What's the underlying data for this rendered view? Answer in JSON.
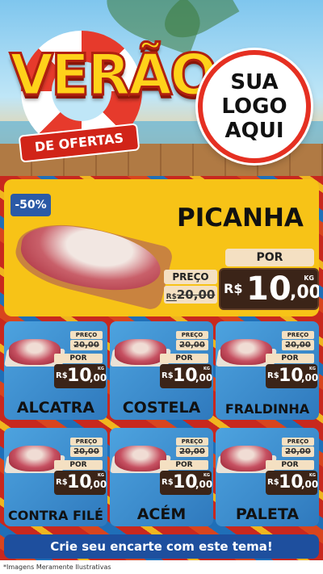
{
  "hero": {
    "title": "VERÃO",
    "subtitle": "DE OFERTAS",
    "logo_lines": [
      "SUA",
      "LOGO",
      "AQUI"
    ]
  },
  "featured": {
    "discount_badge": "-50%",
    "name": "PICANHA",
    "preco_label": "PREÇO",
    "old_price_currency": "R$",
    "old_price": "20,00",
    "por_label": "POR",
    "currency": "R$",
    "price_int": "10",
    "price_dec": ",00",
    "unit": "KG"
  },
  "products": [
    {
      "name": "ALCATRA",
      "preco_label": "PREÇO",
      "old_price": "20,00",
      "por_label": "POR",
      "currency": "R$",
      "price_int": "10",
      "price_dec": ",00",
      "unit": "KG"
    },
    {
      "name": "COSTELA",
      "preco_label": "PREÇO",
      "old_price": "20,00",
      "por_label": "POR",
      "currency": "R$",
      "price_int": "10",
      "price_dec": ",00",
      "unit": "KG"
    },
    {
      "name": "FRALDINHA",
      "preco_label": "PREÇO",
      "old_price": "20,00",
      "por_label": "POR",
      "currency": "R$",
      "price_int": "10",
      "price_dec": ",00",
      "unit": "KG"
    },
    {
      "name": "CONTRA FILÉ",
      "preco_label": "PREÇO",
      "old_price": "20,00",
      "por_label": "POR",
      "currency": "R$",
      "price_int": "10",
      "price_dec": ",00",
      "unit": "KG"
    },
    {
      "name": "ACÉM",
      "preco_label": "PREÇO",
      "old_price": "20,00",
      "por_label": "POR",
      "currency": "R$",
      "price_int": "10",
      "price_dec": ",00",
      "unit": "KG"
    },
    {
      "name": "PALETA",
      "preco_label": "PREÇO",
      "old_price": "20,00",
      "por_label": "POR",
      "currency": "R$",
      "price_int": "10",
      "price_dec": ",00",
      "unit": "KG"
    }
  ],
  "cta": "Crie seu encarte com este tema!",
  "disclaimer": "*Imagens Meramente Ilustrativas",
  "colors": {
    "accent_yellow": "#f7c317",
    "card_blue": "#3a8fd0",
    "cta_blue": "#1e4f9e",
    "brand_red": "#e53022",
    "price_box": "#3b2418"
  }
}
